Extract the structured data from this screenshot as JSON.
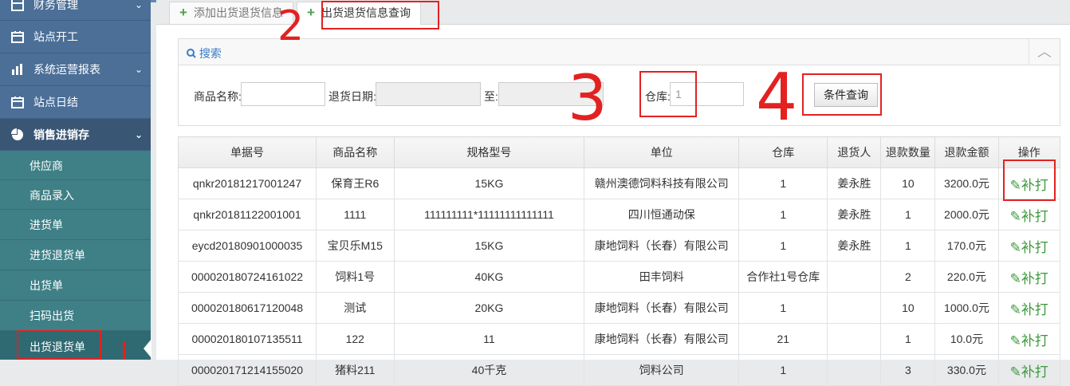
{
  "sidebar": {
    "menu": [
      {
        "label": "财务管理",
        "icon": "calculator-icon",
        "chevron": "⌄"
      },
      {
        "label": "站点开工",
        "icon": "calendar-icon",
        "chevron": ""
      },
      {
        "label": "系统运营报表",
        "icon": "bar-chart-icon",
        "chevron": "⌄"
      },
      {
        "label": "站点日结",
        "icon": "calendar-icon",
        "chevron": ""
      },
      {
        "label": "销售进销存",
        "icon": "pie-chart-icon",
        "chevron": "⌄"
      }
    ],
    "submenu": [
      "供应商",
      "商品录入",
      "进货单",
      "进货退货单",
      "出货单",
      "扫码出货",
      "出货退货单"
    ]
  },
  "tabs": [
    {
      "label": "添加出货退货信息",
      "plus": "+"
    },
    {
      "label": "出货退货信息查询",
      "plus": "+"
    }
  ],
  "search": {
    "title": "搜索",
    "collapse": "︿",
    "product_label": "商品名称:",
    "date_label": "退货日期:",
    "to_label": "至:",
    "warehouse_label": "仓库:",
    "warehouse_value": "1",
    "query_button": "条件查询"
  },
  "table": {
    "headers": [
      "单据号",
      "商品名称",
      "规格型号",
      "单位",
      "仓库",
      "退货人",
      "退款数量",
      "退款金额",
      "操作"
    ],
    "rows": [
      [
        "qnkr20181217001247",
        "保育王R6",
        "15KG",
        "赣州澳德饲料科技有限公司",
        "1",
        "姜永胜",
        "10",
        "3200.0元",
        "✎补打"
      ],
      [
        "qnkr20181122001001",
        "1111",
        "111111111*11111111111111",
        "四川恒通动保",
        "1",
        "姜永胜",
        "1",
        "2000.0元",
        "✎补打"
      ],
      [
        "eycd20180901000035",
        "宝贝乐M15",
        "15KG",
        "康地饲料（长春）有限公司",
        "1",
        "姜永胜",
        "1",
        "170.0元",
        "✎补打"
      ],
      [
        "000020180724161022",
        "饲料1号",
        "40KG",
        "田丰饲料",
        "合作社1号仓库",
        "",
        "2",
        "220.0元",
        "✎补打"
      ],
      [
        "000020180617120048",
        "测试",
        "20KG",
        "康地饲料（长春）有限公司",
        "1",
        "",
        "10",
        "1000.0元",
        "✎补打"
      ],
      [
        "000020180107135511",
        "122",
        "11",
        "康地饲料（长春）有限公司",
        "21",
        "",
        "1",
        "10.0元",
        "✎补打"
      ],
      [
        "000020171214155020",
        "猪料211",
        "40千克",
        "饲料公司",
        "1",
        "",
        "3",
        "330.0元",
        "✎补打"
      ]
    ]
  },
  "annotations": [
    "2",
    "3",
    "4"
  ]
}
